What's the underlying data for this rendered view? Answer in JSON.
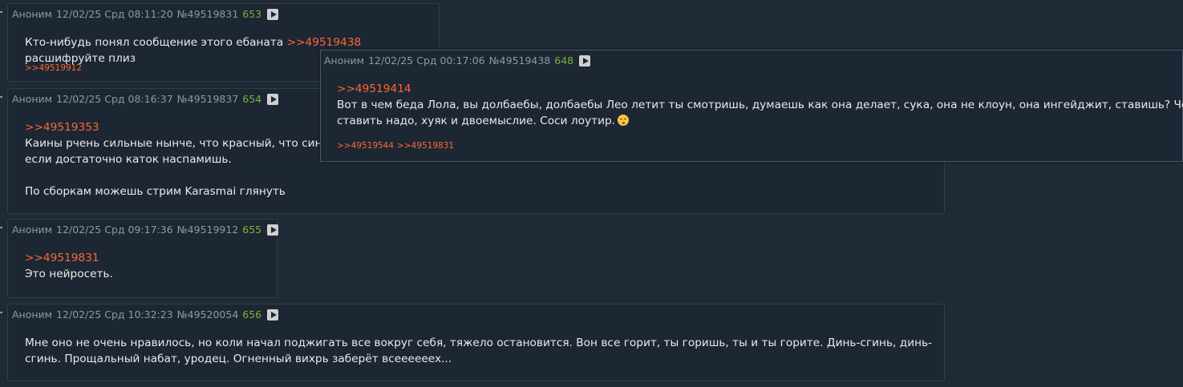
{
  "posts": [
    {
      "author": "Аноним",
      "date": "12/02/25 Срд 08:11:20",
      "id": "№49519831",
      "count": "653",
      "lines": [
        {
          "pre": "Кто-нибудь понял сообщение этого ебаната ",
          "link": ">>49519438",
          "post": " расшифруйте плиз"
        }
      ],
      "replies": [
        ">>49519912"
      ]
    },
    {
      "author": "Аноним",
      "date": "12/02/25 Срд 08:16:37",
      "id": "№49519837",
      "count": "654",
      "quote": ">>49519353",
      "lines": [
        "Каины рчень сильные нынче, что красный, что синий",
        "если достаточно каток наспамишь.",
        "",
        "По сборкам можешь стрим Karasmai глянуть"
      ]
    },
    {
      "author": "Аноним",
      "date": "12/02/25 Срд 09:17:36",
      "id": "№49519912",
      "count": "655",
      "quote": ">>49519831",
      "lines": [
        "Это нейросеть."
      ]
    },
    {
      "author": "Аноним",
      "date": "12/02/25 Срд 10:32:23",
      "id": "№49520054",
      "count": "656",
      "lines": [
        "Мне оно не очень нравилось, но коли начал поджигать все вокруг себя, тяжело остановится. Вон все горит, ты горишь, ты и ты горите. Динь-сгинь, динь-",
        "сгинь. Прощальный набат, уродец. Огненный вихрь заберёт всееееeex..."
      ]
    }
  ],
  "popup": {
    "author": "Аноним",
    "date": "12/02/25 Срд 00:17:06",
    "id": "№49519438",
    "count": "648",
    "quote": ">>49519414",
    "line1": "Вот в чем беда Лола, вы долбаебы, долбаебы Лео летит ты смотришь, думаешь как она делает, сука, она не клоун, она ингейджит, ставишь? Чё там",
    "line2": "ставить надо, хуяк и двоемыслие. Соси лоутир.",
    "emoji": "face-blowing-kiss",
    "replies": [
      ">>49519544",
      ">>49519831"
    ]
  },
  "colors": {
    "background": "#1f2a36",
    "post_bg": "#1c2733",
    "link": "#ff6633",
    "count": "#7ab03c",
    "meta": "#8f99a3"
  }
}
